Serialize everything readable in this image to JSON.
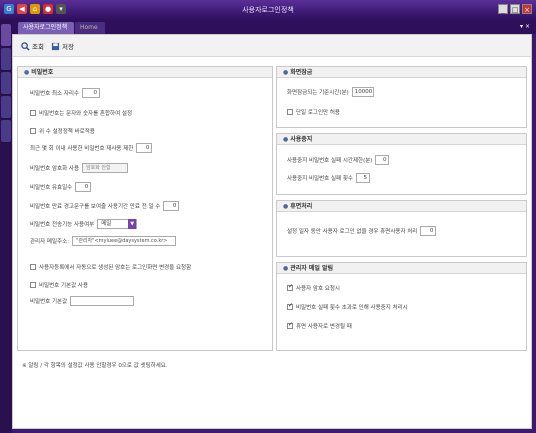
{
  "window": {
    "title": "사용자로그인정책",
    "controls": [
      "_",
      "□",
      "×"
    ]
  },
  "tabs": {
    "active": "사용자로그인정책",
    "home": "Home",
    "right_controls": "▾ ×"
  },
  "toolbar": {
    "search_label": "조회",
    "save_label": "저장"
  },
  "password_panel": {
    "title": "비밀번호",
    "min_length_label": "비밀번호 최소 자리수",
    "min_length_value": "0",
    "mix_label": "비밀번호는 문자와 숫자를 혼합하여 설정",
    "apply_after_label": "위 수 설정정책 바로적용",
    "reuse_label": "최근 몇 회 이내 사용한 비밀번호 재사용 제한",
    "reuse_value": "0",
    "encrypt_label": "비밀번호 암호화 사용",
    "encrypt_value": "암호화 안함",
    "expire_label": "비밀번호 유효일수",
    "expire_value": "0",
    "notice_days_label": "비밀번호 만료 경고문구를 보여줄 사용기간 만료 전 일 수",
    "notice_days_value": "0",
    "send_label": "비밀번호 전송기능 사용여부",
    "send_value": "메일",
    "admin_mail_label": "관리자 메일주소:",
    "admin_mail_value": "\"관리자\"<myluee@daysystem.co.kr>",
    "force_change_label": "사용자등록에서 자동으로 생성된 암호는 로그인화면 변경을 요청함",
    "default_label": "비밀번호 기본값 사용",
    "default_value_label": "비밀번호 기본값"
  },
  "screen_lock_panel": {
    "title": "화면잠금",
    "lock_time_label": "화면잠금되는 기준시간(분)",
    "lock_time_value": "10000",
    "login_release_label": "단일 로그인만 허용"
  },
  "user_lock_panel": {
    "title": "사용중지",
    "lock_time_label": "사용중지 비밀번호 실패 시간제한(분)",
    "lock_time_value": "0",
    "fail_count_label": "사용중지 비밀번호 실패 횟수",
    "fail_count_value": "5"
  },
  "dormant_panel": {
    "title": "휴면처리",
    "days_label": "설정 일자 동안 사용자 로그인 없을 경우 휴면사용자 처리",
    "days_value": "0"
  },
  "admin_mail_panel": {
    "title": "관리자 메일 알림",
    "items": [
      {
        "label": "사용자 암호 요청시",
        "checked": true
      },
      {
        "label": "비밀번호 실패 횟수 초과로 인해 사용중지 처리시",
        "checked": true
      },
      {
        "label": "휴면 사용자로 변경될 때",
        "checked": true
      }
    ]
  },
  "footnote": "※ 알림 / 각 항목의 설정값 사용 안할경우 0으로 값 셋팅하세요.",
  "colors": {
    "titlebar": "#3b1a6b",
    "accent": "#7a3fb0",
    "panel_header": "#f1f1f1"
  }
}
